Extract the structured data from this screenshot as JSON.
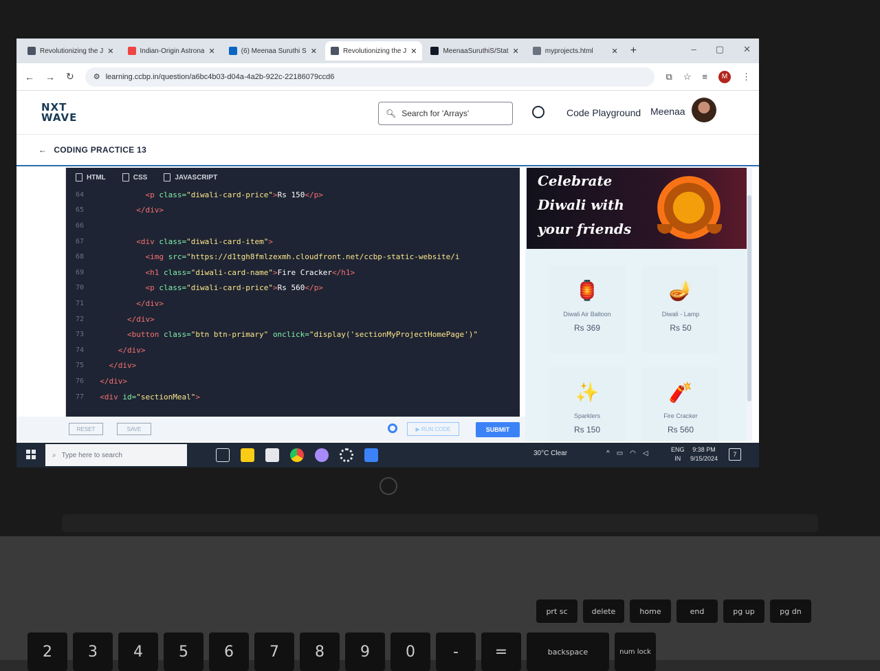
{
  "browser": {
    "tabs": [
      {
        "title": "Revolutionizing the J",
        "color": "#4b5563",
        "active": false
      },
      {
        "title": "Indian-Origin Astrona",
        "color": "#ef4444",
        "active": false
      },
      {
        "title": "(6) Meenaa Suruthi S",
        "color": "#0a66c2",
        "active": false
      },
      {
        "title": "Revolutionizing the J",
        "color": "#4b5563",
        "active": true
      },
      {
        "title": "MeenaaSuruthiS/Stat",
        "color": "#111827",
        "active": false
      },
      {
        "title": "myprojects.html",
        "color": "#6b7280",
        "active": false
      }
    ],
    "url": "learning.ccbp.in/question/a6bc4b03-d04a-4a2b-922c-22186079ccd6",
    "profile_initial": "M"
  },
  "site": {
    "brand_line1": "NXT",
    "brand_line2": "WAVE",
    "search_placeholder": "Search for 'Arrays'",
    "playground_label": "Code Playground",
    "user_name": "Meenaa",
    "page_title": "CODING PRACTICE 13"
  },
  "editor": {
    "tabs": [
      "HTML",
      "CSS",
      "JAVASCRIPT"
    ],
    "lines": [
      {
        "n": "64",
        "indent": "            ",
        "parts": [
          [
            "tg",
            "<p "
          ],
          [
            "at",
            "class="
          ],
          [
            "st",
            "\"diwali-card-price\""
          ],
          [
            "tg",
            ">"
          ],
          [
            "tx",
            "Rs 150"
          ],
          [
            "tg",
            "</p>"
          ]
        ]
      },
      {
        "n": "65",
        "indent": "          ",
        "parts": [
          [
            "tg",
            "</div>"
          ]
        ]
      },
      {
        "n": "66",
        "indent": "",
        "parts": []
      },
      {
        "n": "67",
        "indent": "          ",
        "parts": [
          [
            "tg",
            "<div "
          ],
          [
            "at",
            "class="
          ],
          [
            "st",
            "\"diwali-card-item\""
          ],
          [
            "tg",
            ">"
          ]
        ]
      },
      {
        "n": "68",
        "indent": "            ",
        "parts": [
          [
            "tg",
            "<img "
          ],
          [
            "at",
            "src="
          ],
          [
            "st",
            "\"https://d1tgh8fmlzexmh.cloudfront.net/ccbp-static-website/i"
          ]
        ]
      },
      {
        "n": "69",
        "indent": "            ",
        "parts": [
          [
            "tg",
            "<h1 "
          ],
          [
            "at",
            "class="
          ],
          [
            "st",
            "\"diwali-card-name\""
          ],
          [
            "tg",
            ">"
          ],
          [
            "tx",
            "Fire Cracker"
          ],
          [
            "tg",
            "</h1>"
          ]
        ]
      },
      {
        "n": "70",
        "indent": "            ",
        "parts": [
          [
            "tg",
            "<p "
          ],
          [
            "at",
            "class="
          ],
          [
            "st",
            "\"diwali-card-price\""
          ],
          [
            "tg",
            ">"
          ],
          [
            "tx",
            "Rs 560"
          ],
          [
            "tg",
            "</p>"
          ]
        ]
      },
      {
        "n": "71",
        "indent": "          ",
        "parts": [
          [
            "tg",
            "</div>"
          ]
        ]
      },
      {
        "n": "72",
        "indent": "        ",
        "parts": [
          [
            "tg",
            "</div>"
          ]
        ]
      },
      {
        "n": "73",
        "indent": "        ",
        "parts": [
          [
            "tg",
            "<button "
          ],
          [
            "at",
            "class="
          ],
          [
            "st",
            "\"btn btn-primary\" "
          ],
          [
            "at",
            "onclick="
          ],
          [
            "st",
            "\"display('sectionMyProjectHomePage')\""
          ]
        ]
      },
      {
        "n": "74",
        "indent": "      ",
        "parts": [
          [
            "tg",
            "</div>"
          ]
        ]
      },
      {
        "n": "75",
        "indent": "    ",
        "parts": [
          [
            "tg",
            "</div>"
          ]
        ]
      },
      {
        "n": "76",
        "indent": "  ",
        "parts": [
          [
            "tg",
            "</div>"
          ]
        ]
      },
      {
        "n": "77",
        "indent": "  ",
        "parts": [
          [
            "tg",
            "<div "
          ],
          [
            "at",
            "id="
          ],
          [
            "st",
            "\"sectionMeal\""
          ],
          [
            "tg",
            ">"
          ]
        ]
      }
    ],
    "reset_label": "RESET",
    "save_label": "SAVE",
    "run_label": "▶ RUN CODE",
    "submit_label": "SUBMIT"
  },
  "preview": {
    "banner_line1": "Celebrate",
    "banner_line2": "Diwali with",
    "banner_line3": "your friends",
    "cards": [
      {
        "name": "Diwali Air Balloon",
        "price": "Rs 369",
        "icon": "🏮"
      },
      {
        "name": "Diwali - Lamp",
        "price": "Rs 50",
        "icon": "🪔"
      },
      {
        "name": "Sparklers",
        "price": "Rs 150",
        "icon": "✨"
      },
      {
        "name": "Fire Cracker",
        "price": "Rs 560",
        "icon": "🧨"
      }
    ]
  },
  "taskbar": {
    "search_placeholder": "Type here to search",
    "weather": "30°C  Clear",
    "lang_line1": "ENG",
    "lang_line2": "IN",
    "time": "9:38 PM",
    "date": "9/15/2024",
    "notif_count": "7"
  },
  "keyboard": {
    "fn_row": [
      "prt sc",
      "delete",
      "home",
      "end",
      "pg up",
      "pg dn"
    ],
    "num_row": [
      "2",
      "3",
      "4",
      "5",
      "6",
      "7",
      "8",
      "9",
      "0",
      "-",
      "="
    ],
    "backspace": "backspace",
    "numlock": "num lock"
  }
}
